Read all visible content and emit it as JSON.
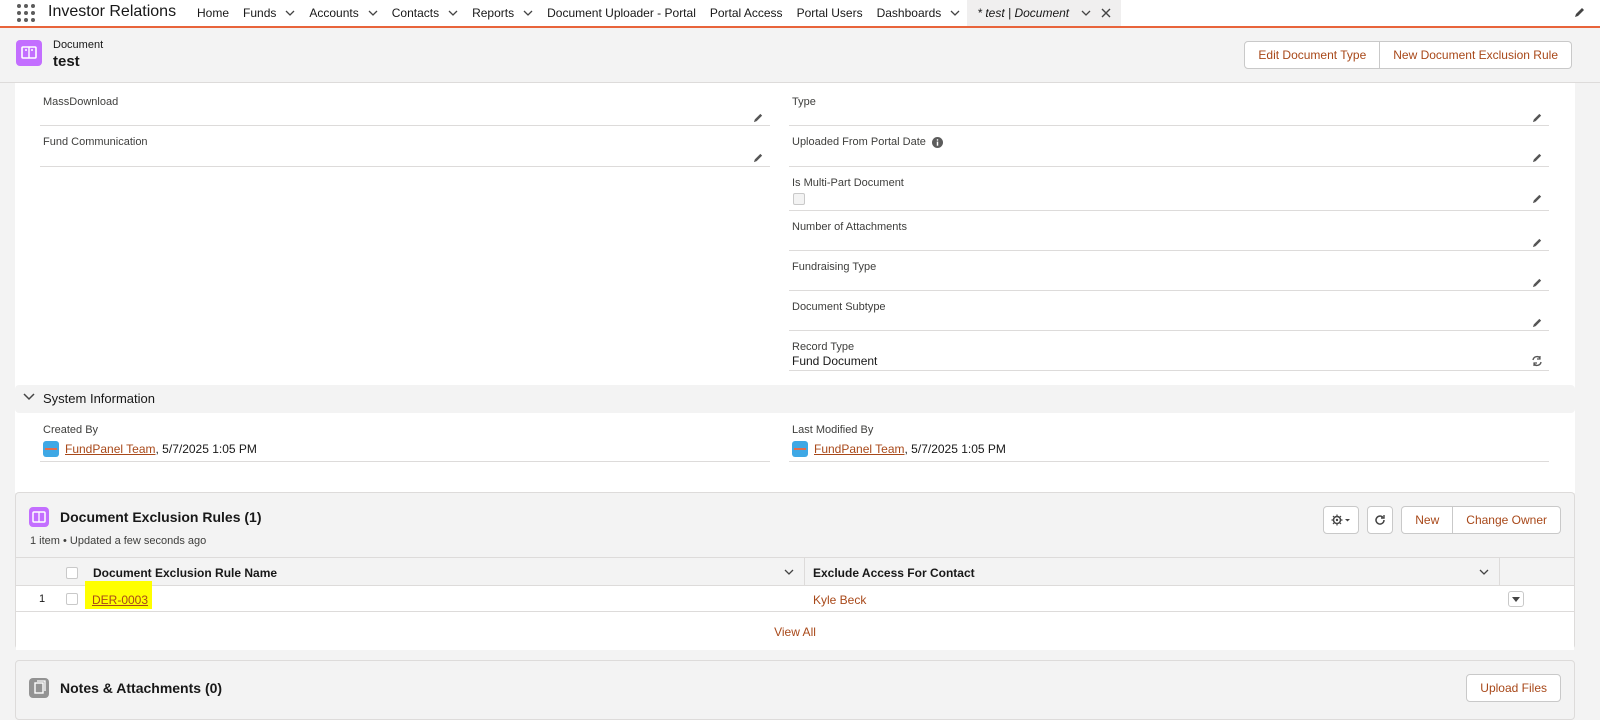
{
  "nav": {
    "app_name": "Investor Relations",
    "items": [
      {
        "label": "Home",
        "dropdown": false
      },
      {
        "label": "Funds",
        "dropdown": true
      },
      {
        "label": "Accounts",
        "dropdown": true
      },
      {
        "label": "Contacts",
        "dropdown": true
      },
      {
        "label": "Reports",
        "dropdown": true
      },
      {
        "label": "Document Uploader - Portal",
        "dropdown": false
      },
      {
        "label": "Portal Access",
        "dropdown": false
      },
      {
        "label": "Portal Users",
        "dropdown": false
      },
      {
        "label": "Dashboards",
        "dropdown": true
      }
    ],
    "active_tab": "* test | Document"
  },
  "record": {
    "type": "Document",
    "name": "test",
    "actions": [
      "Edit Document Type",
      "New Document Exclusion Rule"
    ]
  },
  "fields_left": [
    {
      "label": "MassDownload",
      "value": ""
    },
    {
      "label": "Fund Communication",
      "value": ""
    }
  ],
  "fields_right": [
    {
      "label": "Type",
      "value": ""
    },
    {
      "label": "Uploaded From Portal Date",
      "value": ""
    },
    {
      "label": "Is Multi-Part Document",
      "value": ""
    },
    {
      "label": "Number of Attachments",
      "value": ""
    },
    {
      "label": "Fundraising Type",
      "value": ""
    },
    {
      "label": "Document Subtype",
      "value": ""
    },
    {
      "label": "Record Type",
      "value": "Fund Document"
    }
  ],
  "system_info": {
    "title": "System Information",
    "created_by": {
      "label": "Created By",
      "user": "FundPanel Team",
      "date": ", 5/7/2025 1:05 PM"
    },
    "last_modified_by": {
      "label": "Last Modified By",
      "user": "FundPanel Team",
      "date": ", 5/7/2025 1:05 PM"
    }
  },
  "related_list": {
    "title": "Document Exclusion Rules (1)",
    "subtitle": "1 item • Updated a few seconds ago",
    "buttons": [
      "New",
      "Change Owner"
    ],
    "columns": [
      "Document Exclusion Rule Name",
      "Exclude Access For Contact"
    ],
    "rows": [
      {
        "num": "1",
        "name": "DER-0003",
        "contact": "Kyle Beck"
      }
    ],
    "view_all": "View All"
  },
  "notes": {
    "title": "Notes & Attachments (0)",
    "upload": "Upload Files"
  },
  "colors": {
    "accent": "#a84819",
    "nav_border": "#e8643b",
    "record_icon": "#c36eff",
    "highlight": "#ffff00"
  }
}
